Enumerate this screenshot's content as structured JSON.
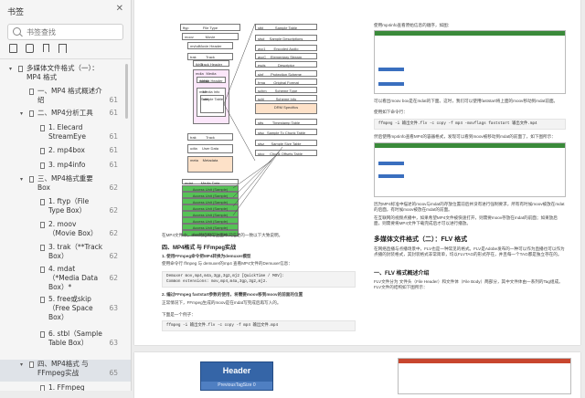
{
  "sidebar": {
    "title": "书签",
    "search_placeholder": "书签查找",
    "items": [
      {
        "label": "多媒体文件格式（一）：MP4 格式",
        "page": "",
        "level": 0,
        "expanded": true
      },
      {
        "label": "一、MP4 格式概述介绍",
        "page": "61",
        "level": 1
      },
      {
        "label": "二、MP4分析工具",
        "page": "61",
        "level": 1,
        "expanded": true
      },
      {
        "label": "1. Elecard StreamEye",
        "page": "61",
        "level": 2
      },
      {
        "label": "2. mp4box",
        "page": "61",
        "level": 2
      },
      {
        "label": "3. mp4info",
        "page": "61",
        "level": 2
      },
      {
        "label": "三、MP4格式重要Box",
        "page": "62",
        "level": 1,
        "expanded": true
      },
      {
        "label": "1. ftyp（File Type Box）",
        "page": "62",
        "level": 2
      },
      {
        "label": "2. moov（Movie Box）",
        "page": "62",
        "level": 2
      },
      {
        "label": "3. trak（**Track Box）",
        "page": "62",
        "level": 2
      },
      {
        "label": "4. mdat（*Media Data Box）*",
        "page": "62",
        "level": 2
      },
      {
        "label": "5. free或skip（Free Space Box）",
        "page": "63",
        "level": 2
      },
      {
        "label": "6. stbl（Sample Table Box）",
        "page": "63",
        "level": 2
      },
      {
        "label": "四、MP4格式 与 FFmpeg实战",
        "page": "65",
        "level": 1,
        "expanded": true
      },
      {
        "label": "1. FFmpeg",
        "page": "",
        "level": 2
      }
    ]
  },
  "document": {
    "left": {
      "fig_caption": "在MP4文件中，Box的结构与上面中间描述的一致以下大致说明。",
      "section_title": "四、MP4格式 与 FFmpeg实战",
      "sub1": "1. 使用FFmpeg命令把MP4转换为demuxer模型",
      "p1": "使用命令行 ffmpeg 与 demuxer的mp4 查看MP4文件的Demuxer信息：",
      "code1_a": "Demuxer mov,mp4,m4a,3gp,3g2,mj2 [QuickTime / MOV]:",
      "code1_b": "Common extensions: mov,mp4,m4a,3gp,3g2,mj2.",
      "sub2": "2. 编过FFmpeg faststart参数的使用，将需要moov移到moov的前面的位置",
      "p2": "正常情况下，FFmpeg生成的moov是在mdat写完成后再写入的。",
      "p3": "下面是一个例子：",
      "code2": "ffmpeg -i 输出文件.flv -c copy -f mp4 输出文件.mp4"
    },
    "right": {
      "p_top": "使用mp4info查看原始信息的顺序，如图：",
      "p_mid": "可以看出moov box是在mdat的下面。这时，我们可以使用faststart将上面的moov移动到mdat前面。",
      "p_mid2": "使用如下命令行：",
      "code3": "ffmpeg -i 输出文件.flv -c copy -f mp4 -movflags faststart 输出文件.mp4",
      "p_after": "然后使用mp4info查看MP4的容器格式，发现可以看到moov被移动到mdat的前面了，如下图所示：",
      "p_bottom": "因为MP4标准中描述的moov与mdat的存放位置前后并没有进行强制要求，所有有时候moov被放在mdat的后面，有时候moov被放在mdat的前面。",
      "p_bottom2": "在互联网的视频点播中，如果希望MP4文件被快速打开，则需要moov存放在mdat的前面；如果放后面，则需要将MP4文件下载完成后才可以进行播放。",
      "section_flv": "多媒体文件格式（二）：FLV 格式",
      "p_flv": "在网络直播与点播场景中，FLV也是一种常见的格式。FLV是Adobe发布的一种可以作为直播也可以作为点播的封装格式，其封装格式非常简单，均以FLVTAG的形式存在，并且每一个TAG都是独立存在的。",
      "sub_flv": "一、FLV 格式概述介绍",
      "p_flv2": "FLV文件分为 文件头（File Header）和文件体（File Body）两部分，其中文件体由一系列的Tag组成。FLV文件的结构如下图所示："
    },
    "page2": {
      "header_box": "Header",
      "sub_box": "PreviousTagSize 0"
    }
  },
  "diagram": {
    "rows": [
      {
        "tag": "ftyp",
        "name": "File Type"
      },
      {
        "tag": "moov",
        "name": "Movie"
      },
      {
        "tag": "mvhd",
        "name": "Movie Header"
      },
      {
        "tag": "trak",
        "name": "Track"
      },
      {
        "tag": "tkhd",
        "name": "Track Header"
      },
      {
        "tag": "mdia",
        "name": "Media"
      },
      {
        "tag": "mdhd",
        "name": "Media Header"
      },
      {
        "tag": "minf",
        "name": "Media Info"
      },
      {
        "tag": "stbl",
        "name": "Sample Table"
      },
      {
        "tag": "trak",
        "name": "Track"
      },
      {
        "tag": "udta",
        "name": "User Data"
      },
      {
        "tag": "meta",
        "name": "Metadata"
      },
      {
        "tag": "mdat",
        "name": "Media Data"
      }
    ],
    "access_units": [
      "Access Unit (Sample)",
      "Access Unit (Sample)",
      "Access Unit (Sample)",
      "Access Unit (Sample)",
      "Access Unit (Sample)",
      "Access Unit (Sample)",
      "Access Unit (Sample)",
      "Access Unit (Sample)"
    ],
    "stbl_rows": [
      {
        "tag": "stbl",
        "name": "Sample Table"
      },
      {
        "tag": "stsd",
        "name": "Sample Descriptions"
      },
      {
        "tag": "avc1",
        "name": "Encoded Audio"
      },
      {
        "tag": "avcC",
        "name": "Elementary Stream"
      },
      {
        "tag": "esds",
        "name": "Descriptor"
      },
      {
        "tag": "sinf",
        "name": "Protection Scheme"
      },
      {
        "tag": "frma",
        "name": "Original Format"
      },
      {
        "tag": "schm",
        "name": "Scheme Type"
      },
      {
        "tag": "schi",
        "name": "Scheme Info"
      },
      {
        "tag": "",
        "name": "DRM Specifics"
      },
      {
        "tag": "stts",
        "name": "Timestamp Table"
      },
      {
        "tag": "stsc",
        "name": "Sample To Chunk Table"
      },
      {
        "tag": "stsz",
        "name": "Sample Size Table"
      },
      {
        "tag": "stco",
        "name": "Chunk Offsets Table"
      }
    ]
  },
  "colors": {
    "accent": "#3a6fbf",
    "green": "#56c256",
    "orange": "#f3b47c",
    "pink": "#e9b2e6"
  }
}
